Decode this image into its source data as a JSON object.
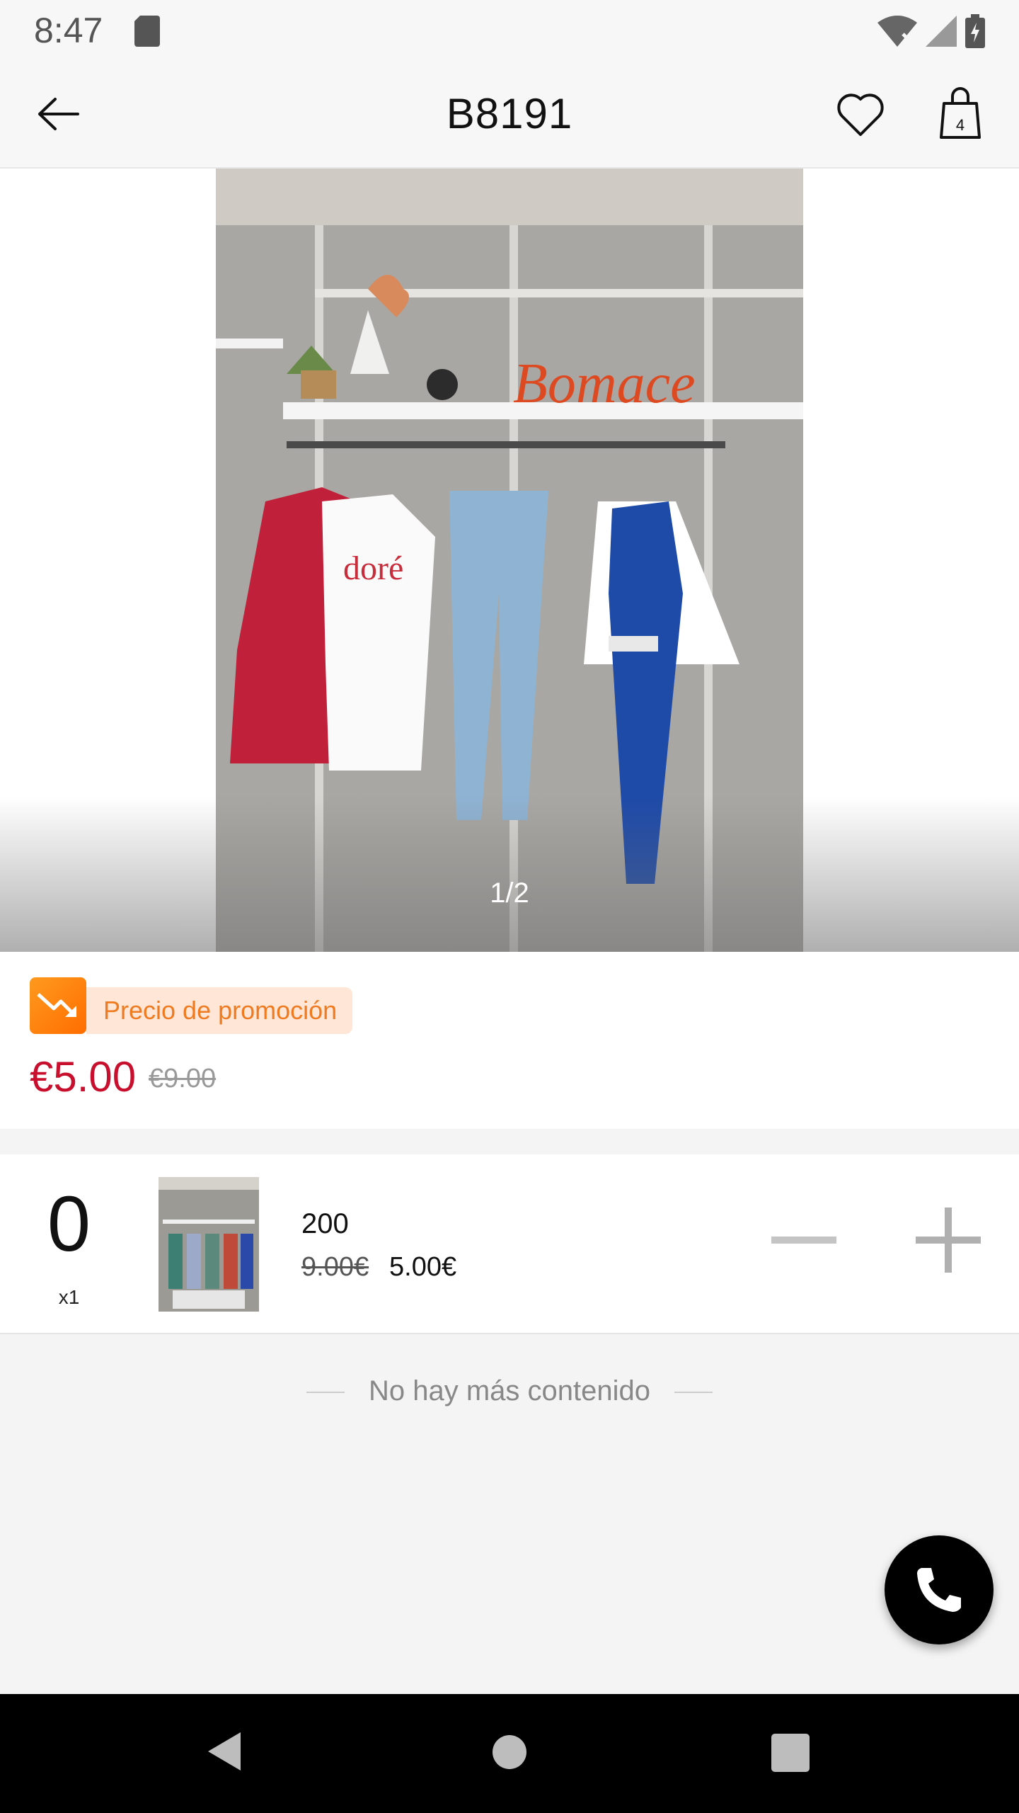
{
  "status_bar": {
    "time": "8:47"
  },
  "header": {
    "title": "B8191",
    "cart_count": "4"
  },
  "gallery": {
    "counter": "1/2"
  },
  "promotion": {
    "tag": "Precio de promoción",
    "price_now": "€5.00",
    "price_was": "€9.00"
  },
  "sku": {
    "quantity": "0",
    "multiplier": "x1",
    "name": "200",
    "price_was": "9.00€",
    "price_now": "5.00€"
  },
  "footer": {
    "end_note": "No hay más contenido"
  },
  "colors": {
    "accent_price": "#c8102e",
    "promo_orange": "#f07a1f",
    "promo_bg": "#ffe6d6"
  },
  "icons": [
    "back-arrow-icon",
    "heart-icon",
    "shopping-bag-icon",
    "phone-icon",
    "minus-icon",
    "plus-icon"
  ]
}
